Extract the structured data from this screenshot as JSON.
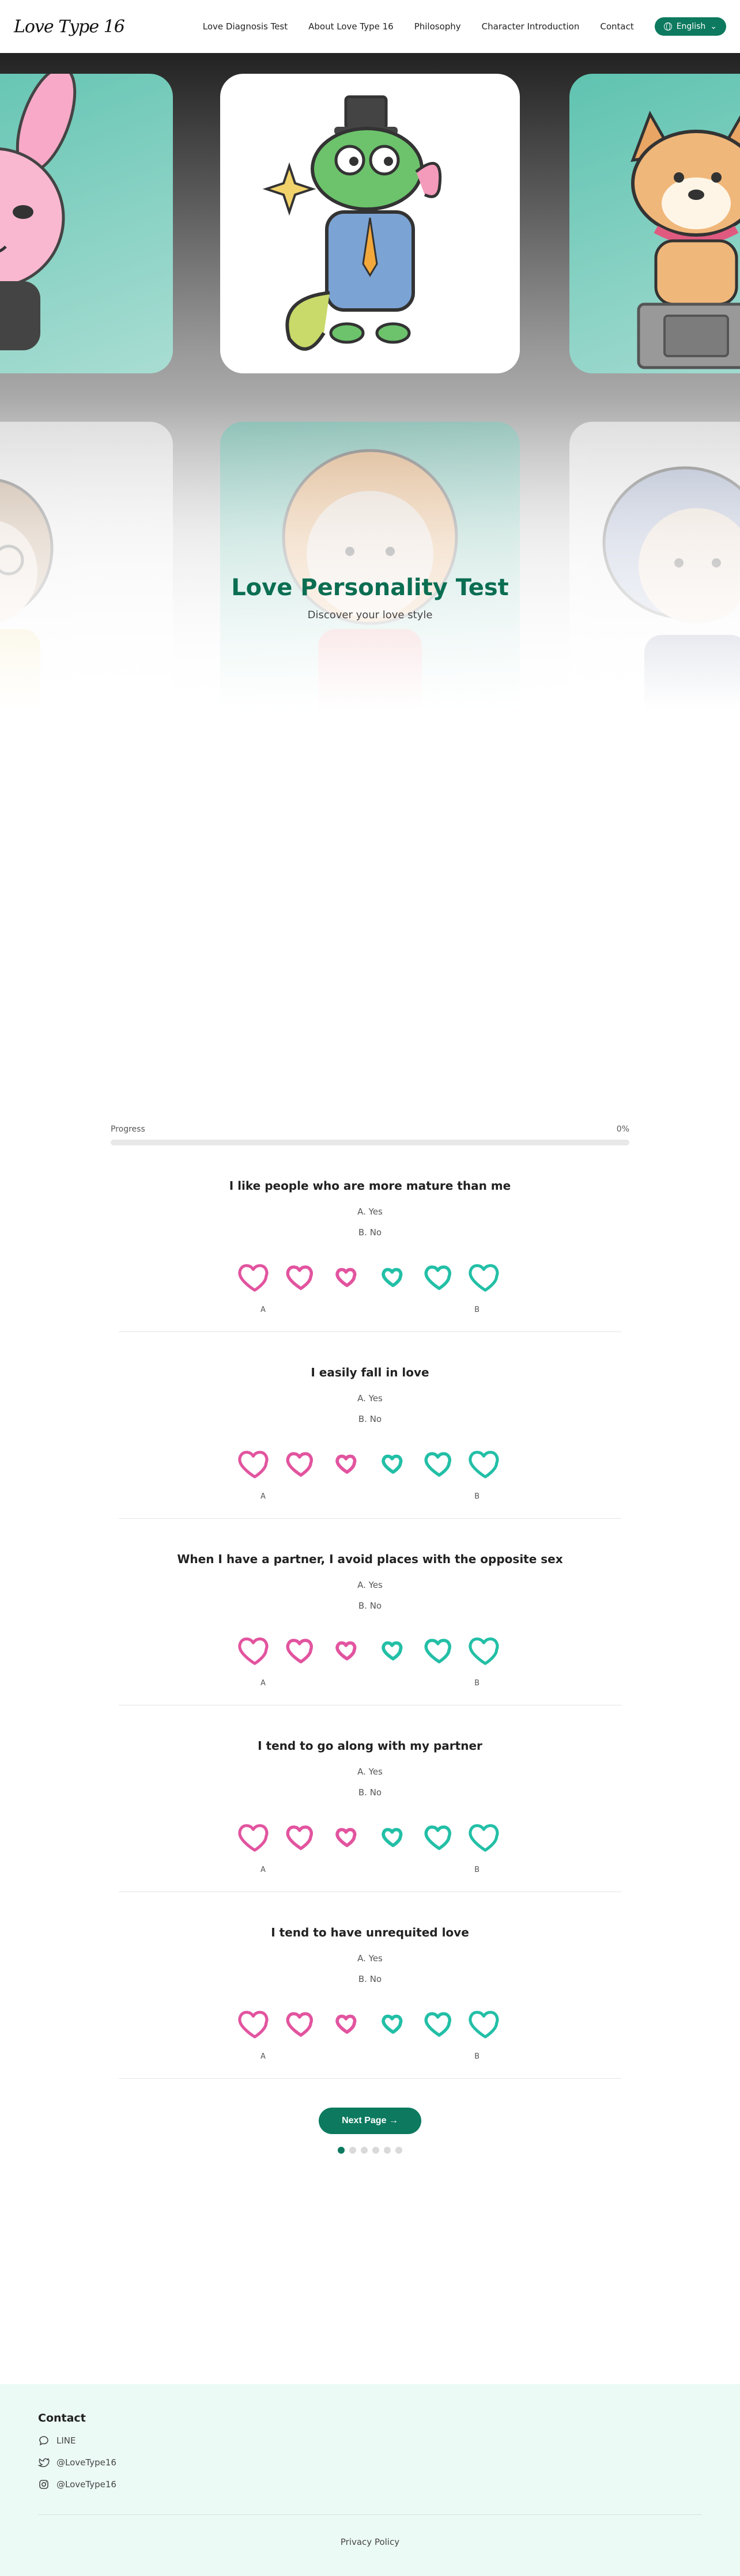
{
  "header": {
    "logo": "Love Type 16",
    "nav": [
      "Love Diagnosis Test",
      "About Love Type 16",
      "Philosophy",
      "Character Introduction",
      "Contact"
    ],
    "language": "English"
  },
  "hero": {
    "title": "Love Personality Test",
    "subtitle": "Discover your love style"
  },
  "progress": {
    "label": "Progress",
    "value_text": "0%",
    "value": 0
  },
  "questions": [
    {
      "text": "I like people who are more mature than me",
      "option_a": "A. Yes",
      "option_b": "B. No",
      "scale_left": "A",
      "scale_right": "B"
    },
    {
      "text": "I easily fall in love",
      "option_a": "A. Yes",
      "option_b": "B. No",
      "scale_left": "A",
      "scale_right": "B"
    },
    {
      "text": "When I have a partner, I avoid places with the opposite sex",
      "option_a": "A. Yes",
      "option_b": "B. No",
      "scale_left": "A",
      "scale_right": "B"
    },
    {
      "text": "I tend to go along with my partner",
      "option_a": "A. Yes",
      "option_b": "B. No",
      "scale_left": "A",
      "scale_right": "B"
    },
    {
      "text": "I tend to have unrequited love",
      "option_a": "A. Yes",
      "option_b": "B. No",
      "scale_left": "A",
      "scale_right": "B"
    }
  ],
  "scale_colors": [
    "#e2549f",
    "#e2549f",
    "#e2549f",
    "#22bfa6",
    "#22bfa6",
    "#22bfa6"
  ],
  "next_button": "Next Page →",
  "pagination": {
    "pages": 6,
    "current": 1
  },
  "footer": {
    "heading": "Contact",
    "links": [
      {
        "icon": "chat-bubble-icon",
        "label": "LINE"
      },
      {
        "icon": "twitter-icon",
        "label": "@LoveType16"
      },
      {
        "icon": "instagram-icon",
        "label": "@LoveType16"
      }
    ],
    "privacy": "Privacy Policy"
  },
  "colors": {
    "brand": "#0d7a5f",
    "pink": "#e2549f",
    "teal": "#22bfa6",
    "footer_bg": "#ecfaf6"
  }
}
